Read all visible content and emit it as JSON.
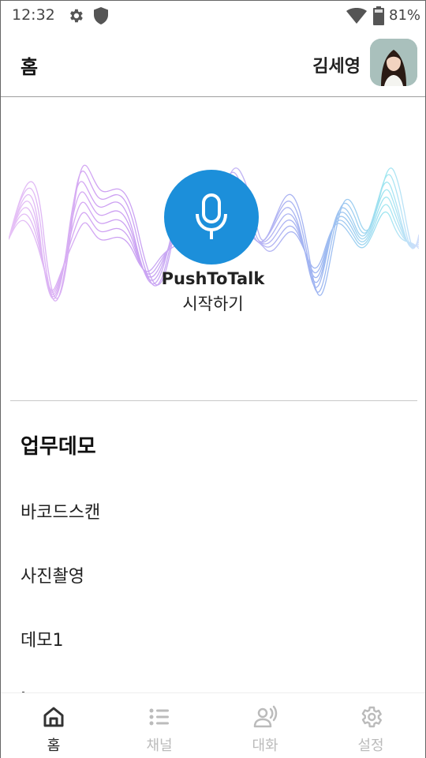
{
  "status_bar": {
    "time": "12:32",
    "battery": "81%"
  },
  "app_bar": {
    "title": "홈",
    "user_name": "김세영"
  },
  "hero": {
    "ptt_label": "PushToTalk",
    "ptt_sub": "시작하기"
  },
  "section": {
    "title": "업무데모",
    "items": [
      "바코드스캔",
      "사진촬영",
      "데모1"
    ]
  },
  "bottom_nav": [
    {
      "label": "홈",
      "icon": "home-icon",
      "active": true
    },
    {
      "label": "채널",
      "icon": "list-icon",
      "active": false
    },
    {
      "label": "대화",
      "icon": "person-voice-icon",
      "active": false
    },
    {
      "label": "설정",
      "icon": "gear-icon",
      "active": false
    }
  ],
  "colors": {
    "accent": "#1c8fda",
    "inactive": "#bbbbbb",
    "divider": "#c8c8c8"
  }
}
